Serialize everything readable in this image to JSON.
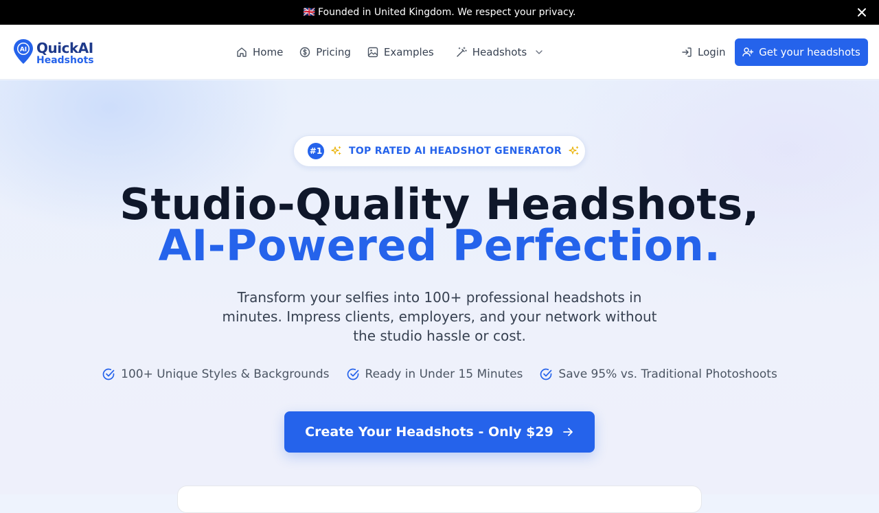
{
  "announcement": {
    "flag": "🇬🇧",
    "text": "Founded in United Kingdom. We respect your privacy."
  },
  "brand": {
    "line1": "QuickAI",
    "line2": "Headshots",
    "mark": "AI",
    "color": "#2563eb"
  },
  "nav": {
    "items": [
      {
        "label": "Home",
        "icon": "home-icon"
      },
      {
        "label": "Pricing",
        "icon": "dollar-circle-icon"
      },
      {
        "label": "Examples",
        "icon": "image-icon"
      },
      {
        "label": "Headshots",
        "icon": "magic-wand-icon"
      }
    ],
    "login": "Login",
    "cta": "Get your headshots"
  },
  "hero": {
    "badge_number": "#1",
    "badge_text": "TOP RATED AI HEADSHOT GENERATOR",
    "title_line1": "Studio-Quality Headshots,",
    "title_line2": "AI-Powered Perfection.",
    "subtitle": "Transform your selfies into 100+ professional headshots in minutes. Impress clients, employers, and your network without the studio hassle or cost.",
    "features": [
      "100+ Unique Styles & Backgrounds",
      "Ready in Under 15 Minutes",
      "Save 95% vs. Traditional Photoshoots"
    ],
    "cta": "Create Your Headshots - Only $29"
  }
}
